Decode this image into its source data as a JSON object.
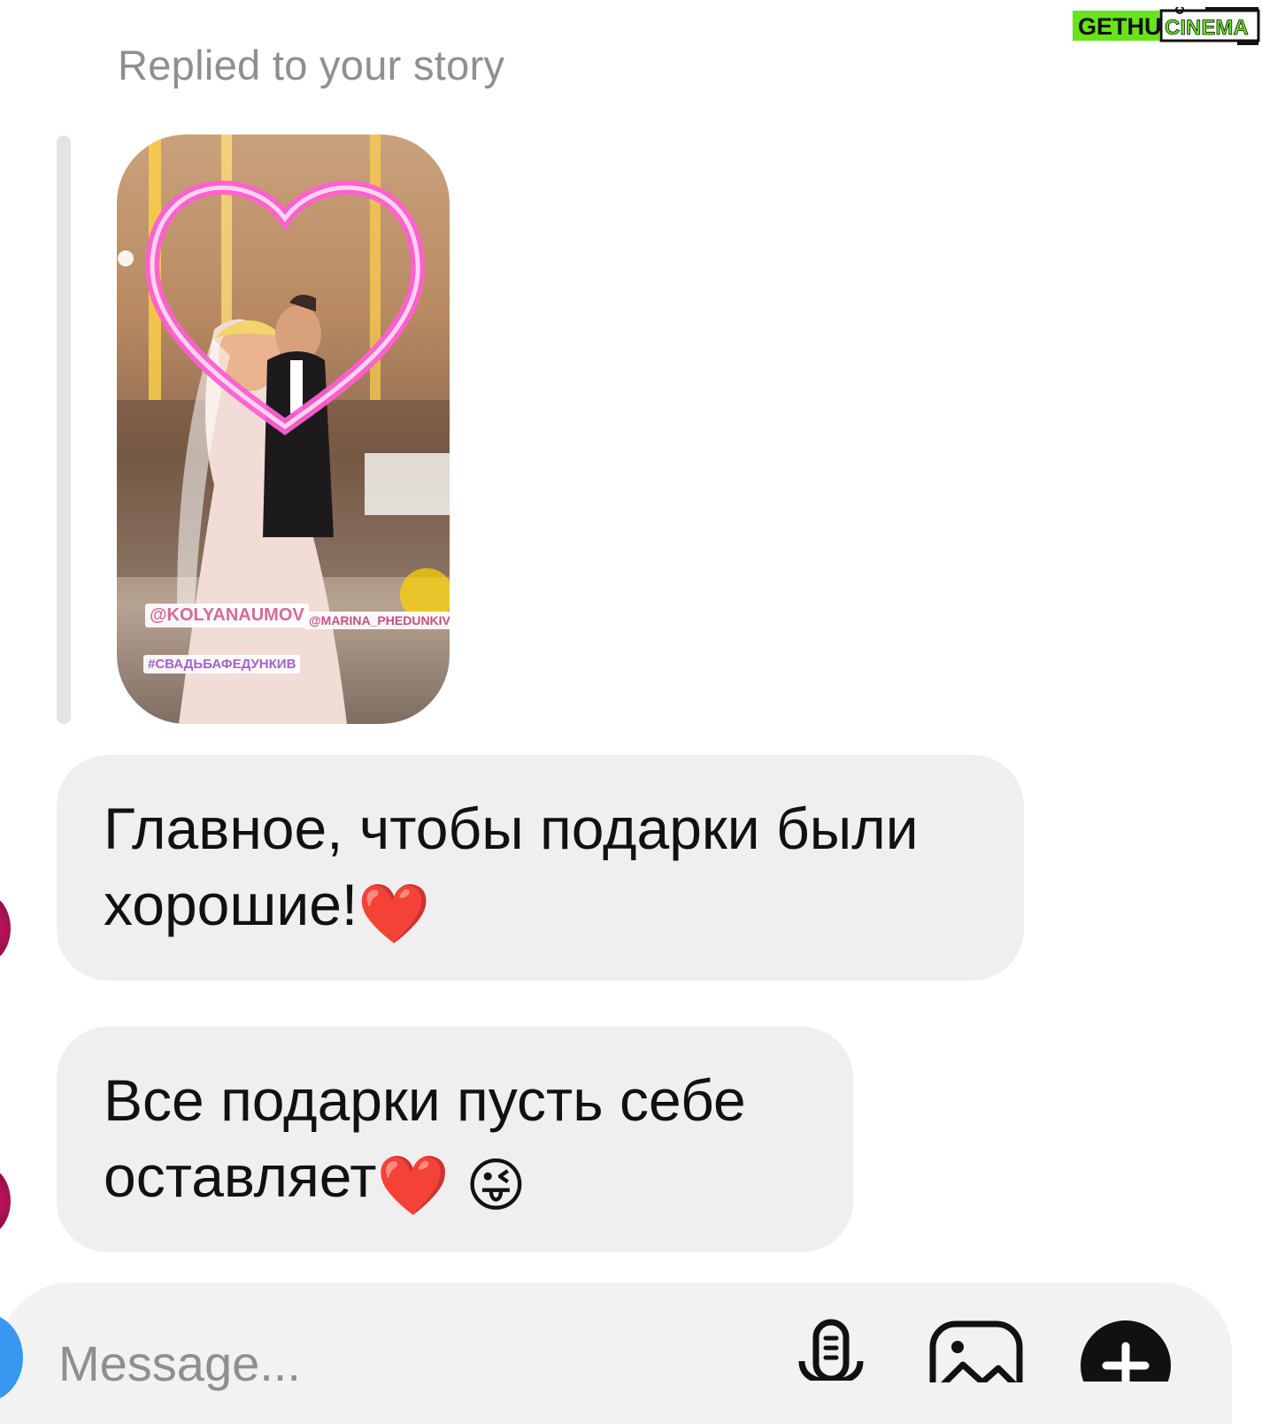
{
  "header": {
    "reply_label": "Replied to your story"
  },
  "story": {
    "tags": [
      "@KOLYANAUMOV",
      "@MARINA_PHEDUNKIV",
      "#СВАДЬБАФЕДУНКИВ"
    ]
  },
  "messages": [
    {
      "text": "Главное, чтобы подарки были хорошие!",
      "emojis": [
        "❤️"
      ]
    },
    {
      "text": "Все подарки пусть себе оставляет",
      "emojis": [
        "❤️",
        "😜"
      ]
    }
  ],
  "composer": {
    "placeholder": "Message..."
  },
  "watermark": {
    "left": "GETHU",
    "right": "CINEMA"
  },
  "colors": {
    "bubble": "#efefef",
    "label": "#8e8e93",
    "heart": "#ff5fd0",
    "camera_button": "#3897f0",
    "watermark_green": "#69e31c"
  }
}
